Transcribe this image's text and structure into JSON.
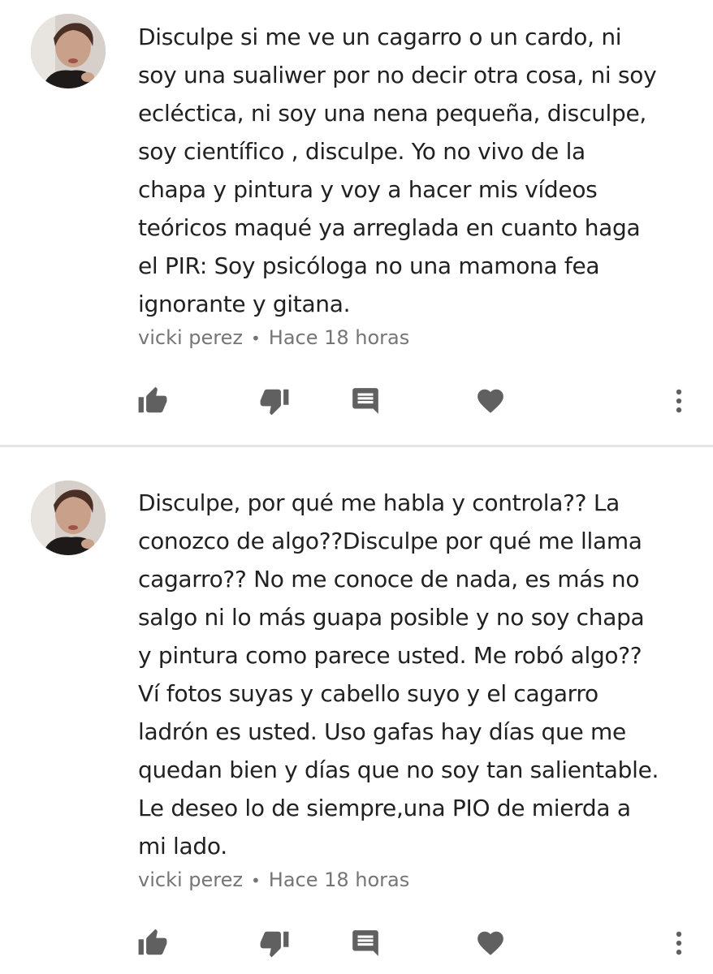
{
  "comments": [
    {
      "text": "Disculpe si me ve un cagarro o un cardo, ni\nsoy una sualiwer por no decir otra cosa, ni soy\necléctica, ni soy una nena pequeña, disculpe,\nsoy científico , disculpe. Yo no vivo de la\nchapa y pintura y voy a hacer mis vídeos\nteóricos maqué ya arreglada en cuanto haga\nel PIR: Soy psicóloga no una mamona fea\nignorante y gitana.",
      "author": "vicki perez",
      "separator": "•",
      "time": "Hace 18 horas"
    },
    {
      "text": "Disculpe, por qué me habla y controla?? La\nconozco de algo??Disculpe por qué me llama\ncagarro?? No me conoce de nada, es más no\nsalgo ni lo más guapa posible y no soy chapa\ny pintura como parece usted. Me robó algo??\nVí fotos suyas y cabello suyo y el cagarro\nladrón es usted. Uso gafas  hay días que me\nquedan bien y días que no soy tan salientable.\nLe deseo lo de siempre,una PIO de mierda a\nmi lado.",
      "author": "vicki perez",
      "separator": "•",
      "time": "Hace 18 horas"
    }
  ],
  "icons": {
    "like": "thumb-up-icon",
    "dislike": "thumb-down-icon",
    "reply": "comment-icon",
    "heart": "heart-icon",
    "more": "more-vertical-icon"
  },
  "colors": {
    "text": "#212121",
    "meta": "#757575",
    "icon": "#606060",
    "divider": "#e4e4e4"
  }
}
